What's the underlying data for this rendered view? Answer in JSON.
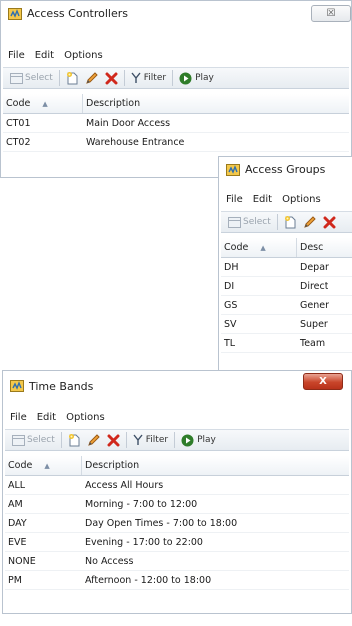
{
  "windows": {
    "access_controllers": {
      "title": "Access Controllers",
      "close_label": "☒",
      "menu": [
        "File",
        "Edit",
        "Options"
      ],
      "toolbar": {
        "select": "Select",
        "filter": "Filter",
        "play": "Play"
      },
      "columns": {
        "code": "Code",
        "description": "Description"
      },
      "rows": [
        {
          "code": "CT01",
          "description": "Main Door Access"
        },
        {
          "code": "CT02",
          "description": "Warehouse Entrance"
        }
      ]
    },
    "access_groups": {
      "title": "Access Groups",
      "menu": [
        "File",
        "Edit",
        "Options"
      ],
      "toolbar": {
        "select": "Select"
      },
      "columns": {
        "code": "Code",
        "description": "Desc"
      },
      "rows": [
        {
          "code": "DH",
          "description": "Depar"
        },
        {
          "code": "DI",
          "description": "Direct"
        },
        {
          "code": "GS",
          "description": "Gener"
        },
        {
          "code": "SV",
          "description": "Super"
        },
        {
          "code": "TL",
          "description": "Team"
        }
      ]
    },
    "time_bands": {
      "title": "Time Bands",
      "close_label": "X",
      "menu": [
        "File",
        "Edit",
        "Options"
      ],
      "toolbar": {
        "select": "Select",
        "filter": "Filter",
        "play": "Play"
      },
      "columns": {
        "code": "Code",
        "description": "Description"
      },
      "rows": [
        {
          "code": "ALL",
          "description": "Access All Hours"
        },
        {
          "code": "AM",
          "description": "Morning - 7:00 to 12:00"
        },
        {
          "code": "DAY",
          "description": "Day Open Times - 7:00 to 18:00"
        },
        {
          "code": "EVE",
          "description": "Evening - 17:00 to 22:00"
        },
        {
          "code": "NONE",
          "description": "No Access"
        },
        {
          "code": "PM",
          "description": "Afternoon - 12:00 to 18:00"
        }
      ]
    }
  },
  "colors": {
    "accent": "#2f6fb0",
    "delete": "#d0281c",
    "play": "#2f7d2a",
    "close_active": "#c9452a"
  }
}
